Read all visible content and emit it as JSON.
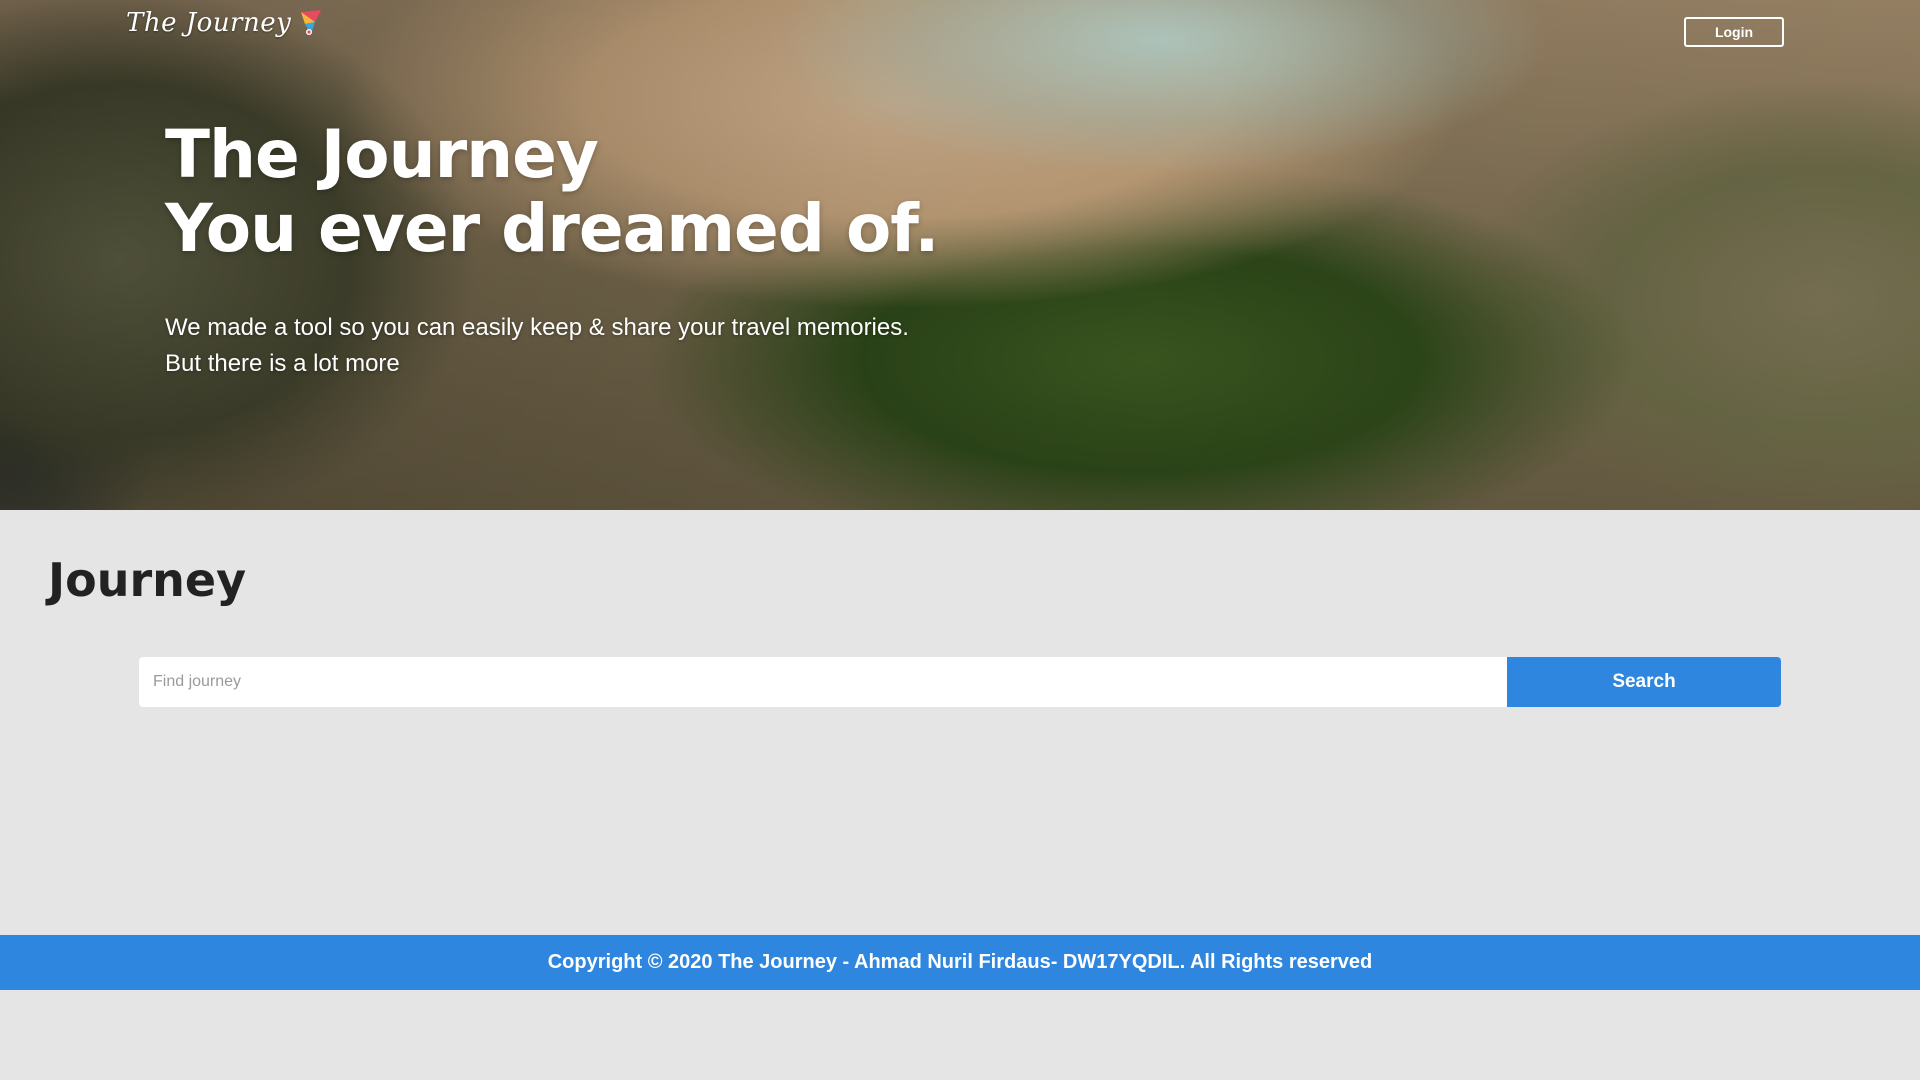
{
  "navbar": {
    "logo_text": "The Journey",
    "login_label": "Login"
  },
  "hero": {
    "headline_line1": "The Journey",
    "headline_line2": "You ever dreamed of.",
    "subtext_line1": "We made a tool so you can easily keep & share your travel memories.",
    "subtext_line2": "But there is a lot more"
  },
  "main": {
    "section_title": "Journey",
    "search": {
      "placeholder": "Find journey",
      "value": "",
      "button_label": "Search"
    }
  },
  "footer": {
    "text": "Copyright © 2020 The Journey - Ahmad Nuril Firdaus- DW17YQDIL. All Rights reserved"
  },
  "colors": {
    "accent": "#2e86de",
    "page_background": "#e5e5e5",
    "heading_text": "#222222"
  },
  "icons": {
    "logo_mark": "map-pin-icon"
  }
}
